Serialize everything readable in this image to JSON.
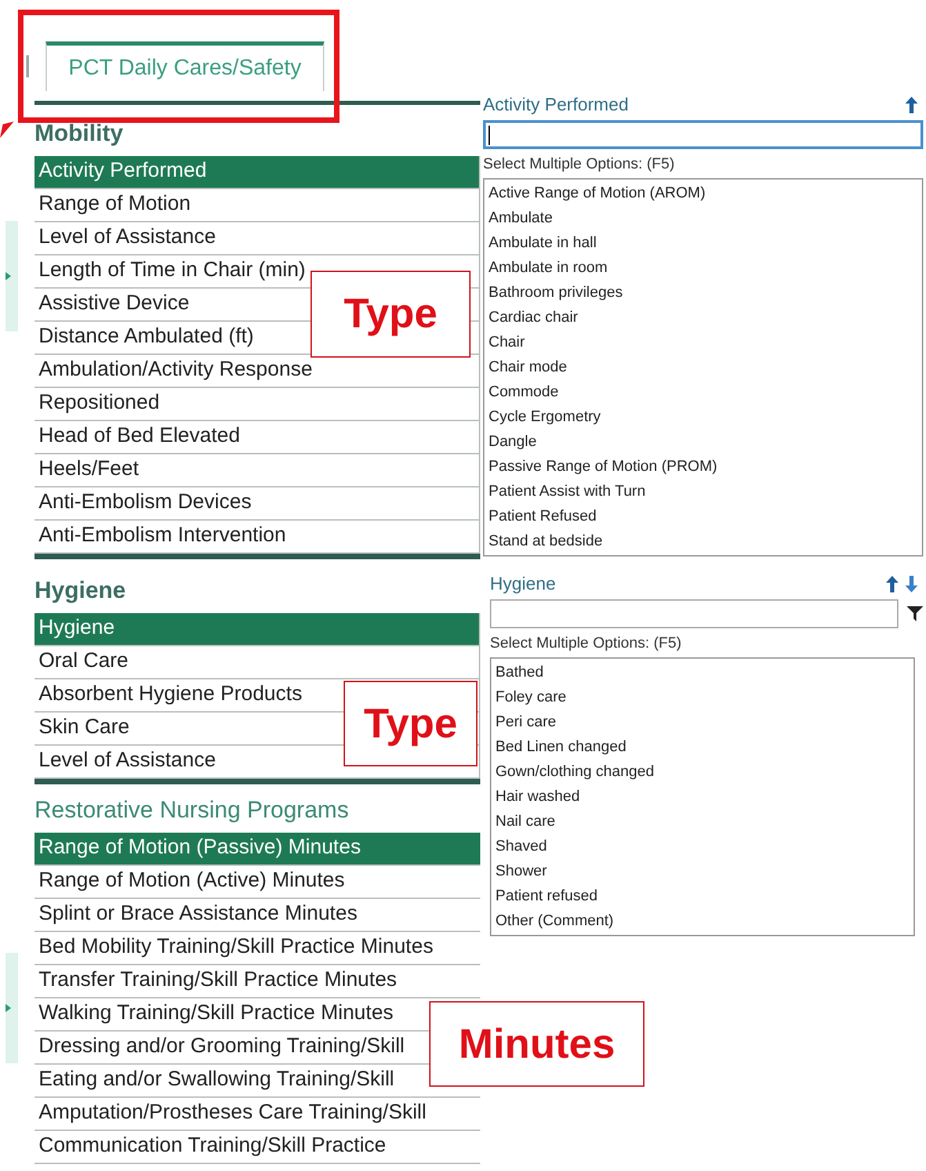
{
  "tab": {
    "label": "PCT Daily Cares/Safety",
    "selected": true
  },
  "sections": [
    {
      "title": "Mobility",
      "items": [
        {
          "label": "Activity Performed",
          "selected": true
        },
        {
          "label": "Range of Motion",
          "selected": false
        },
        {
          "label": "Level of Assistance",
          "selected": false
        },
        {
          "label": "Length of Time in Chair (min)",
          "selected": false
        },
        {
          "label": "Assistive Device",
          "selected": false
        },
        {
          "label": "Distance Ambulated (ft)",
          "selected": false
        },
        {
          "label": "Ambulation/Activity Response",
          "selected": false
        },
        {
          "label": "Repositioned",
          "selected": false
        },
        {
          "label": "Head of Bed Elevated",
          "selected": false
        },
        {
          "label": "Heels/Feet",
          "selected": false
        },
        {
          "label": "Anti-Embolism Devices",
          "selected": false
        },
        {
          "label": "Anti-Embolism Intervention",
          "selected": false
        }
      ]
    },
    {
      "title": "Hygiene",
      "items": [
        {
          "label": "Hygiene",
          "selected": true
        },
        {
          "label": "Oral Care",
          "selected": false
        },
        {
          "label": "Absorbent Hygiene Products",
          "selected": false
        },
        {
          "label": "Skin Care",
          "selected": false
        },
        {
          "label": "Level of Assistance",
          "selected": false
        }
      ]
    },
    {
      "title": "Restorative Nursing Programs",
      "items": [
        {
          "label": "Range of Motion (Passive) Minutes",
          "selected": true
        },
        {
          "label": "Range of Motion (Active) Minutes",
          "selected": false
        },
        {
          "label": "Splint or Brace Assistance Minutes",
          "selected": false
        },
        {
          "label": "Bed Mobility Training/Skill Practice Minutes",
          "selected": false
        },
        {
          "label": "Transfer Training/Skill Practice Minutes",
          "selected": false
        },
        {
          "label": "Walking Training/Skill Practice Minutes",
          "selected": false
        },
        {
          "label": "Dressing and/or Grooming Training/Skill",
          "selected": false
        },
        {
          "label": "Eating and/or Swallowing Training/Skill",
          "selected": false
        },
        {
          "label": "Amputation/Prostheses Care Training/Skill",
          "selected": false
        },
        {
          "label": "Communication Training/Skill Practice",
          "selected": false
        }
      ]
    }
  ],
  "detail_panels": [
    {
      "title": "Activity Performed",
      "nav": [
        {
          "kind": "up"
        }
      ],
      "focused": true,
      "filter": false,
      "hint": "Select Multiple Options: (F5)",
      "options": [
        "Active Range of Motion (AROM)",
        "Ambulate",
        "Ambulate in hall",
        "Ambulate in room",
        "Bathroom privileges",
        "Cardiac chair",
        "Chair",
        "Chair mode",
        "Commode",
        "Cycle Ergometry",
        "Dangle",
        "Passive Range of Motion (PROM)",
        "Patient Assist with Turn",
        "Patient Refused",
        "Stand at bedside"
      ]
    },
    {
      "title": "Hygiene",
      "nav": [
        {
          "kind": "up"
        },
        {
          "kind": "down"
        }
      ],
      "focused": false,
      "filter": true,
      "hint": "Select Multiple Options: (F5)",
      "options": [
        "Bathed",
        "Foley care",
        "Peri care",
        "Bed Linen changed",
        "Gown/clothing changed",
        "Hair washed",
        "Nail care",
        "Shaved",
        "Shower",
        "Patient refused",
        "Other (Comment)"
      ]
    }
  ],
  "annotations": [
    {
      "text": "Type"
    },
    {
      "text": "Type"
    },
    {
      "text": "Minutes"
    }
  ]
}
